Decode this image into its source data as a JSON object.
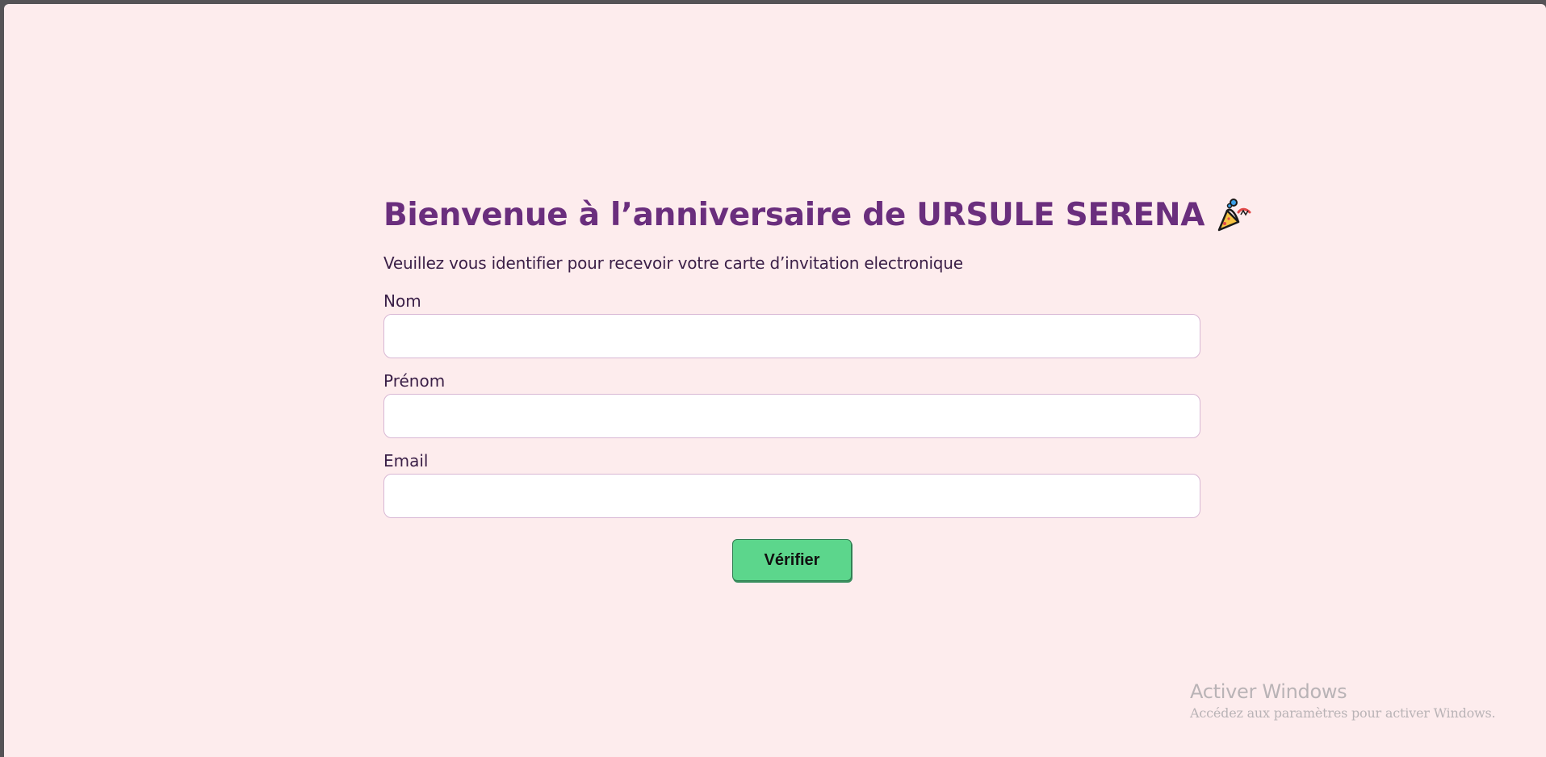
{
  "page": {
    "title": "Bienvenue à l’anniversaire de URSULE SERENA",
    "title_icon": "party-popper-icon",
    "subtitle": "Veuillez vous identifier pour recevoir votre carte d’invitation electronique"
  },
  "form": {
    "fields": [
      {
        "label": "Nom",
        "value": "",
        "placeholder": ""
      },
      {
        "label": "Prénom",
        "value": "",
        "placeholder": ""
      },
      {
        "label": "Email",
        "value": "",
        "placeholder": ""
      }
    ],
    "submit_label": "Vérifier"
  },
  "watermark": {
    "title": "Activer Windows",
    "subtitle": "Accédez aux paramètres pour activer Windows."
  },
  "colors": {
    "background": "#fdeced",
    "title": "#6a2e7d",
    "text": "#3a1f47",
    "button": "#5cd68c",
    "input_border": "#d8b7d4"
  }
}
